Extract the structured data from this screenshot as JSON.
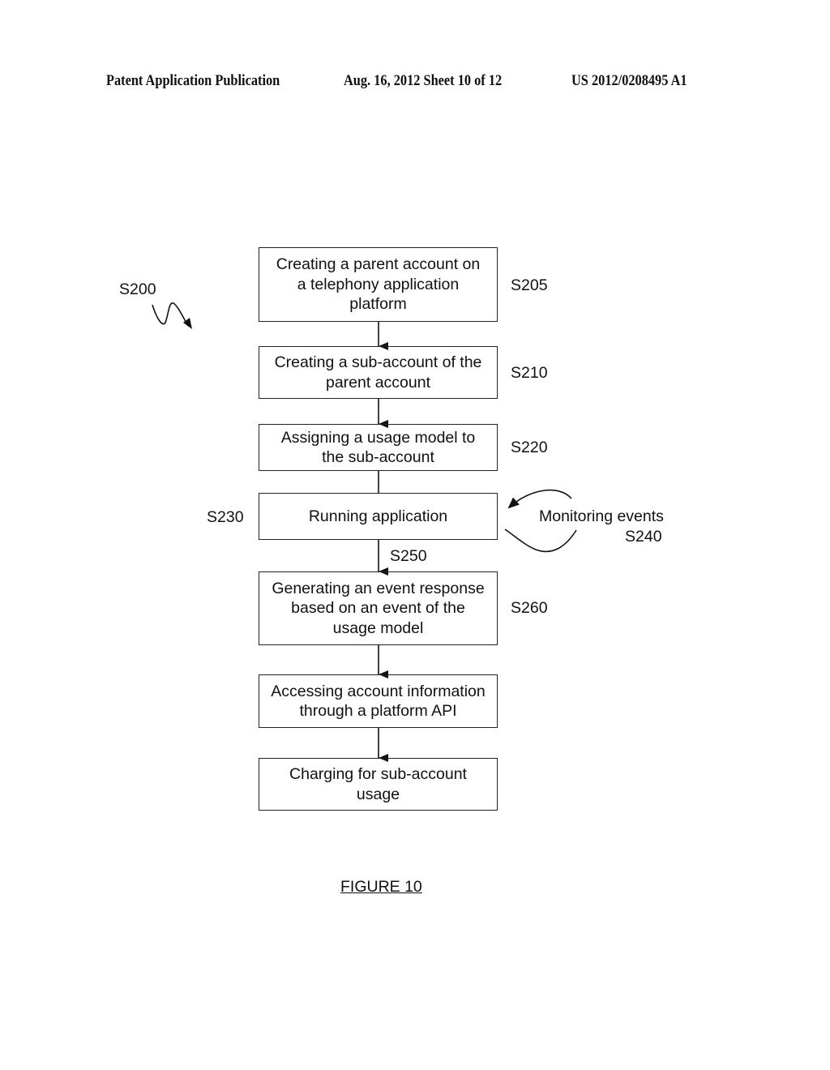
{
  "header": {
    "left": "Patent Application Publication",
    "center": "Aug. 16, 2012  Sheet 10 of 12",
    "right": "US 2012/0208495 A1"
  },
  "diagram": {
    "method_ref": "S200",
    "steps": [
      {
        "text": "Creating a parent account on\na telephony application\nplatform",
        "ref": "S205"
      },
      {
        "text": "Creating a sub-account of the\nparent account",
        "ref": "S210"
      },
      {
        "text": "Assigning a usage model to\nthe sub-account",
        "ref": "S220"
      },
      {
        "text": "Running application",
        "ref": "S230"
      },
      {
        "text": "Generating an event response\nbased on an event of the\nusage model",
        "ref": "S260"
      },
      {
        "text": "Accessing account information\nthrough a platform API",
        "ref": ""
      },
      {
        "text": "Charging for sub-account\nusage",
        "ref": ""
      }
    ],
    "loop": {
      "label": "Monitoring events",
      "ref": "S240"
    },
    "arrow_ref": "S250"
  },
  "figure_caption": "FIGURE 10"
}
